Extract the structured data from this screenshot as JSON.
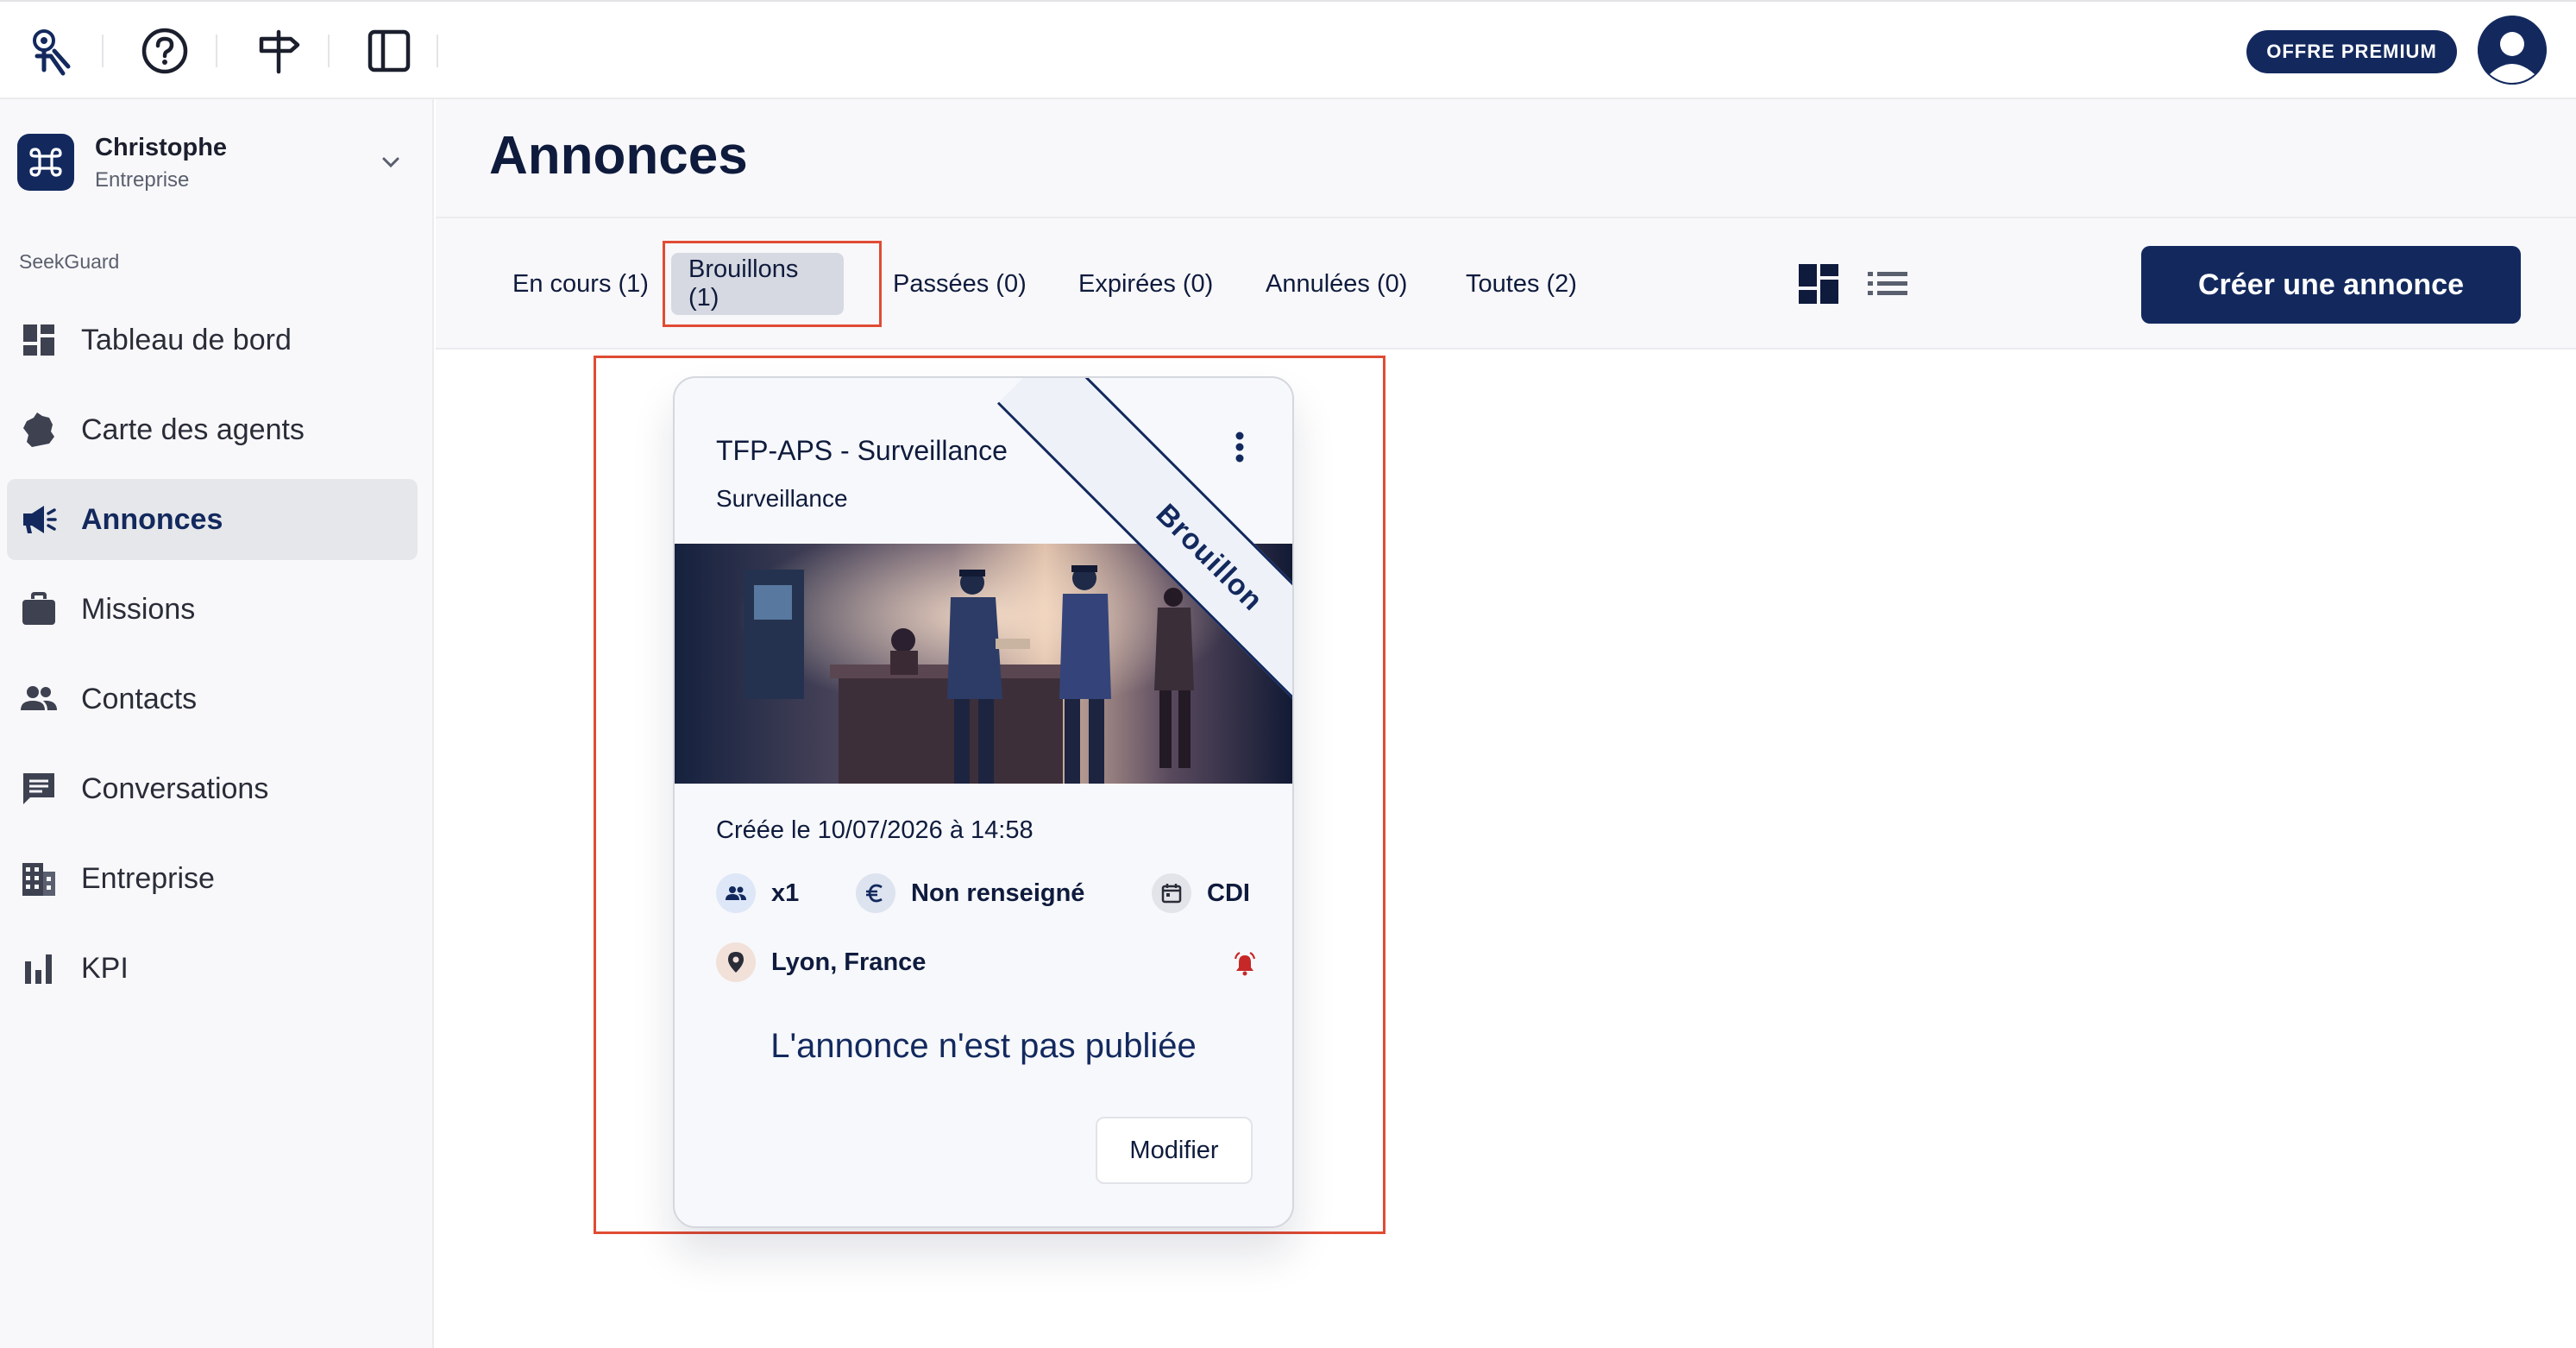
{
  "topbar": {
    "icons": [
      "logo-icon",
      "help-icon",
      "signpost-icon",
      "sidebar-toggle-icon"
    ],
    "premium_label": "OFFRE PREMIUM"
  },
  "sidebar": {
    "org": {
      "name": "Christophe",
      "type": "Entreprise"
    },
    "section_label": "SeekGuard",
    "items": [
      {
        "label": "Tableau de bord",
        "icon": "dashboard-icon"
      },
      {
        "label": "Carte des agents",
        "icon": "france-map-icon"
      },
      {
        "label": "Annonces",
        "icon": "campaign-icon",
        "active": true
      },
      {
        "label": "Missions",
        "icon": "briefcase-icon"
      },
      {
        "label": "Contacts",
        "icon": "people-icon"
      },
      {
        "label": "Conversations",
        "icon": "chat-icon"
      },
      {
        "label": "Entreprise",
        "icon": "building-icon"
      },
      {
        "label": "KPI",
        "icon": "bar-chart-icon"
      }
    ]
  },
  "header": {
    "title": "Annonces"
  },
  "tabs": [
    {
      "label": "En cours (1)"
    },
    {
      "label": "Brouillons (1)",
      "active": true
    },
    {
      "label": "Passées (0)"
    },
    {
      "label": "Expirées (0)"
    },
    {
      "label": "Annulées (0)"
    },
    {
      "label": "Toutes (2)"
    }
  ],
  "actions": {
    "create_label": "Créer une annonce"
  },
  "card": {
    "title": "TFP-APS - Surveillance",
    "subtitle": "Surveillance",
    "ribbon": "Brouillon",
    "created": "Créée le 10/07/2026 à 14:58",
    "positions": "x1",
    "salary": "Non renseigné",
    "contract": "CDI",
    "location": "Lyon, France",
    "status": "L'annonce n'est pas publiée",
    "modify_label": "Modifier"
  },
  "colors": {
    "primary": "#13295e",
    "highlight": "#e04b34",
    "alarm": "#c62828"
  }
}
